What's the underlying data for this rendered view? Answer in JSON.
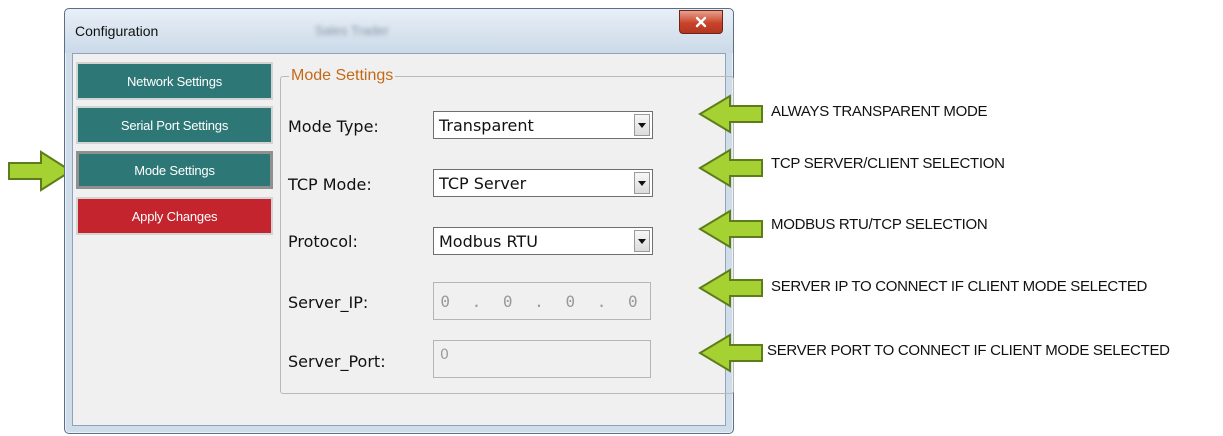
{
  "window": {
    "title": "Configuration",
    "blurred_title": "Sales Trader",
    "close_symbol": "x"
  },
  "nav": {
    "items": [
      {
        "label": "Network Settings"
      },
      {
        "label": "Serial Port Settings"
      },
      {
        "label": "Mode Settings",
        "active": true
      },
      {
        "label": "Apply Changes"
      }
    ]
  },
  "group": {
    "title": "Mode Settings"
  },
  "fields": {
    "mode_type": {
      "label": "Mode Type:",
      "value": "Transparent"
    },
    "tcp_mode": {
      "label": "TCP Mode:",
      "value": "TCP Server"
    },
    "protocol": {
      "label": "Protocol:",
      "value": "Modbus RTU"
    },
    "server_ip": {
      "label": "Server_IP:",
      "value": "0 . 0 . 0 . 0"
    },
    "server_port": {
      "label": "Server_Port:",
      "value": "0"
    }
  },
  "annotations": [
    "ALWAYS TRANSPARENT MODE",
    "TCP SERVER/CLIENT SELECTION",
    "MODBUS RTU/TCP SELECTION",
    "SERVER IP TO CONNECT IF CLIENT MODE SELECTED",
    "SERVER PORT TO CONNECT IF CLIENT MODE SELECTED"
  ],
  "colors": {
    "nav_teal": "#2d7876",
    "nav_red": "#c3242d",
    "group_title": "#c46a17",
    "arrow_green": "#a6d132"
  }
}
